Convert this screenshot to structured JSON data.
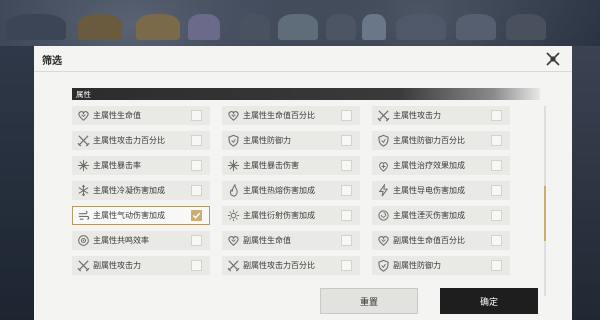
{
  "dialog": {
    "title": "筛选",
    "section_label": "属性",
    "reset_label": "重置",
    "confirm_label": "确定"
  },
  "options": [
    {
      "label": "主属性生命值",
      "icon": "heart-icon",
      "checked": false
    },
    {
      "label": "主属性生命值百分比",
      "icon": "heart-icon",
      "checked": false
    },
    {
      "label": "主属性攻击力",
      "icon": "crossed-swords-icon",
      "checked": false
    },
    {
      "label": "主属性攻击力百分比",
      "icon": "crossed-swords-icon",
      "checked": false
    },
    {
      "label": "主属性防御力",
      "icon": "shield-icon",
      "checked": false
    },
    {
      "label": "主属性防御力百分比",
      "icon": "shield-icon",
      "checked": false
    },
    {
      "label": "主属性暴击率",
      "icon": "burst-icon",
      "checked": false
    },
    {
      "label": "主属性暴击伤害",
      "icon": "burst-icon",
      "checked": false
    },
    {
      "label": "主属性治疗效果加成",
      "icon": "heal-icon",
      "checked": false
    },
    {
      "label": "主属性冷凝伤害加成",
      "icon": "snowflake-icon",
      "checked": false
    },
    {
      "label": "主属性热熔伤害加成",
      "icon": "flame-icon",
      "checked": false
    },
    {
      "label": "主属性导电伤害加成",
      "icon": "lightning-icon",
      "checked": false
    },
    {
      "label": "主属性气动伤害加成",
      "icon": "wind-icon",
      "checked": true
    },
    {
      "label": "主属性衍射伤害加成",
      "icon": "sun-icon",
      "checked": false
    },
    {
      "label": "主属性湮灭伤害加成",
      "icon": "vortex-icon",
      "checked": false
    },
    {
      "label": "主属性共鸣效率",
      "icon": "resonance-icon",
      "checked": false
    },
    {
      "label": "副属性生命值",
      "icon": "heart-icon",
      "checked": false
    },
    {
      "label": "副属性生命值百分比",
      "icon": "heart-icon",
      "checked": false
    },
    {
      "label": "副属性攻击力",
      "icon": "crossed-swords-icon",
      "checked": false
    },
    {
      "label": "副属性攻击力百分比",
      "icon": "crossed-swords-icon",
      "checked": false
    },
    {
      "label": "副属性防御力",
      "icon": "shield-icon",
      "checked": false
    }
  ],
  "colors": {
    "accent": "#c8ae72",
    "icon": "#6f6f6f"
  }
}
